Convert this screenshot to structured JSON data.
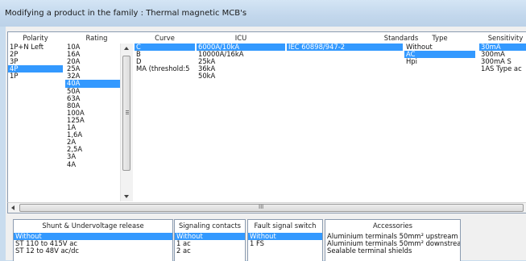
{
  "window": {
    "title": "Modifying a product in the family : Thermal magnetic MCB's"
  },
  "columns": {
    "polarity": {
      "header": "Polarity",
      "items": [
        "1P+N Left",
        "2P",
        "3P",
        "4P",
        "1P"
      ],
      "selected": "4P"
    },
    "rating": {
      "header": "Rating",
      "items": [
        "10A",
        "16A",
        "20A",
        "25A",
        "32A",
        "40A",
        "50A",
        "63A",
        "80A",
        "100A",
        "125A",
        "1A",
        "1,6A",
        "2A",
        "2,5A",
        "3A",
        "4A"
      ],
      "selected": "40A"
    },
    "curve": {
      "header": "Curve",
      "items": [
        "C",
        "B",
        "D",
        "MA (threshold:5"
      ],
      "selected": "C"
    },
    "icu": {
      "header": "ICU",
      "items": [
        "6000A/10kA",
        "10000A/16kA",
        "25kA",
        "36kA",
        "50kA"
      ],
      "selected": "6000A/10kA"
    },
    "standards": {
      "header": "Standards",
      "items": [
        "IEC 60898/947-2"
      ],
      "selected": "IEC 60898/947-2"
    },
    "type": {
      "header": "Type",
      "items": [
        "Without",
        "AC",
        "Hpi"
      ],
      "selected": "AC"
    },
    "sensitivity": {
      "header": "Sensitivity",
      "items": [
        "30mA",
        "300mA",
        "300mA S",
        "1AS Type ac"
      ],
      "selected": "30mA"
    }
  },
  "scrollbar": {
    "h_label": "III"
  },
  "bottom": {
    "shunt": {
      "header": "Shunt & Undervoltage release",
      "items": [
        "Without",
        "ST 110 to  415V ac",
        "ST 12 to 48V  ac/dc"
      ],
      "selected": "Without"
    },
    "signaling": {
      "header": "Signaling contacts",
      "items": [
        "Without",
        "1 ac",
        "2 ac"
      ],
      "selected": "Without"
    },
    "fault": {
      "header": "Fault signal switch",
      "items": [
        "Without",
        "1 FS"
      ],
      "selected": "Without"
    },
    "accessories": {
      "header": "Accessories",
      "items": [
        "Aluminium terminals 50mm² upstream",
        "Aluminium terminals 50mm² downstream",
        "Sealable terminal shields"
      ],
      "selected": ""
    }
  }
}
